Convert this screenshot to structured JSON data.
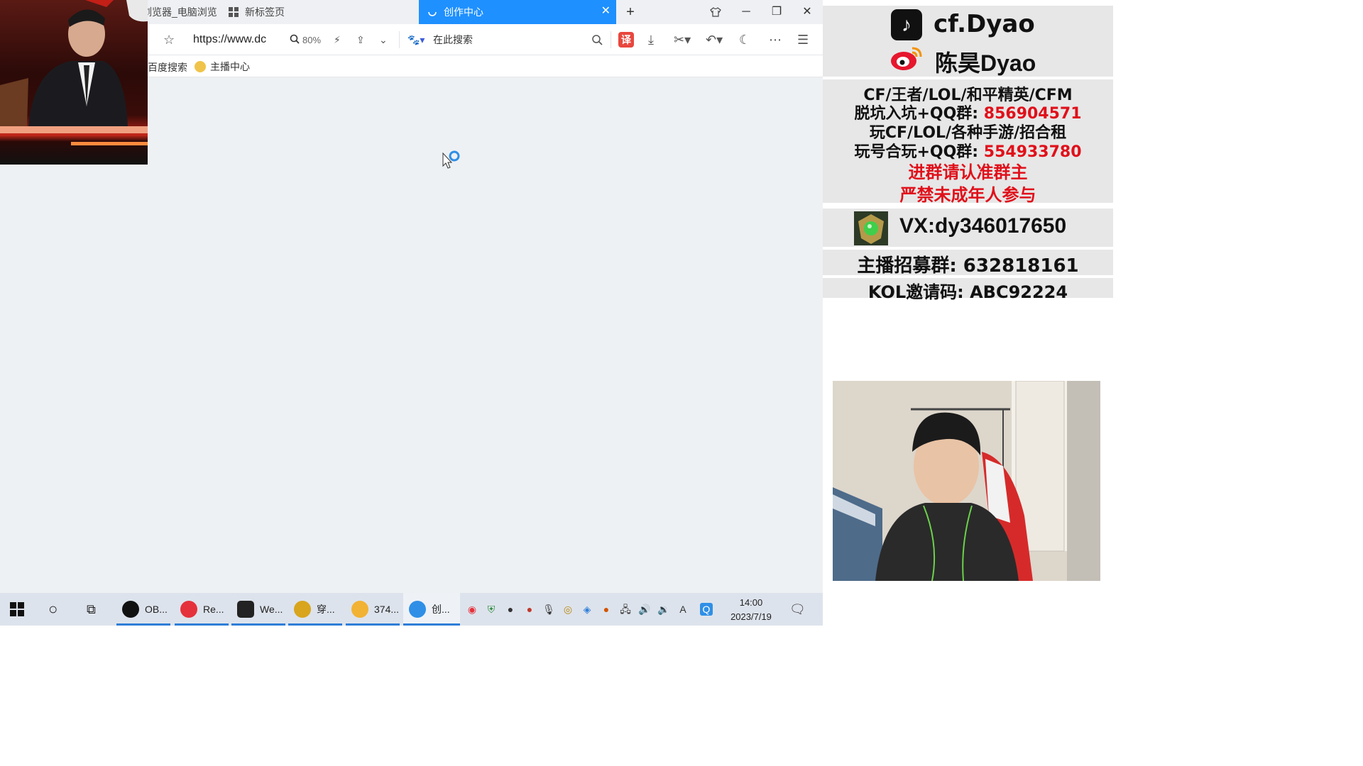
{
  "tabs": [
    {
      "label": "浏览器_电脑浏览"
    },
    {
      "label": "新标签页"
    },
    {
      "label": "创作中心",
      "active": true
    }
  ],
  "new_tab_symbol": "+",
  "address_bar": {
    "url": "https://www.dc",
    "zoom": "80%",
    "search_placeholder": "在此搜索"
  },
  "translate_label": "译",
  "bookmarks": [
    {
      "label": "百度搜索"
    },
    {
      "label": "主播中心"
    }
  ],
  "info_panel": {
    "douyin": "cf.Dyao",
    "weibo": "陈昊Dyao",
    "games_line": "CF/王者/LOL/和平精英/CFM",
    "qq_group_label_1": "脱坑入坑+QQ群:",
    "qq_group_1": "856904571",
    "rent_line": "玩CF/LOL/各种手游/招合租",
    "qq_group_label_2": "玩号合玩+QQ群:",
    "qq_group_2": "554933780",
    "notice_1": "进群请认准群主",
    "notice_2": "严禁未成年人参与",
    "vx": "VX:dy346017650",
    "recruit": "主播招募群: 632818161",
    "kol": "KOL邀请码: ABC92224"
  },
  "taskbar": {
    "apps": [
      {
        "label": "OB..."
      },
      {
        "label": "Re..."
      },
      {
        "label": "We..."
      },
      {
        "label": "穿..."
      },
      {
        "label": "374..."
      },
      {
        "label": "创..."
      }
    ],
    "time": "14:00",
    "date": "2023/7/19",
    "ime": "A"
  },
  "colors": {
    "accent": "#1e90ff",
    "red_text": "#e0101a"
  }
}
